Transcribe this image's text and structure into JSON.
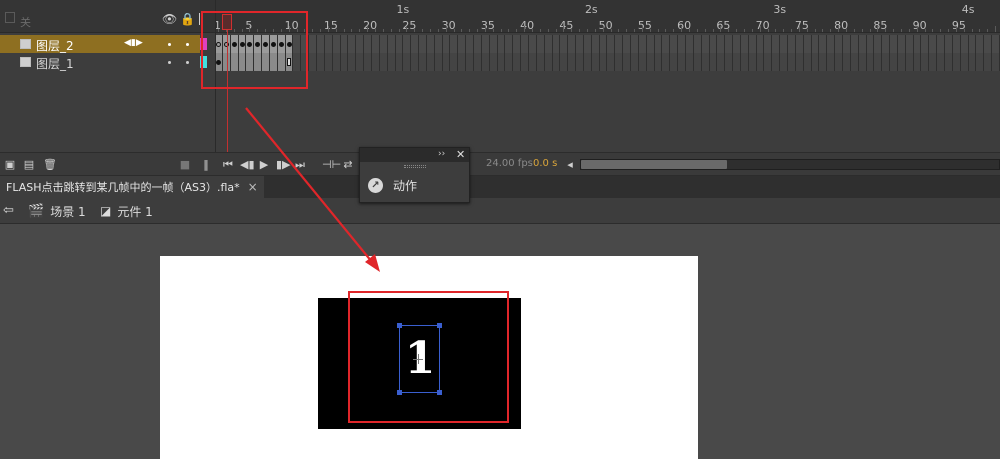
{
  "timeline": {
    "header_label": "关",
    "layers": [
      {
        "name": "图层_2",
        "selected": true,
        "color": "#e040c0"
      },
      {
        "name": "图层_1",
        "selected": false,
        "color": "#40e0e0"
      }
    ],
    "frame_numbers": [
      "1",
      "5",
      "10",
      "15",
      "20",
      "25",
      "30",
      "35",
      "40",
      "45",
      "50",
      "55",
      "60",
      "65",
      "70",
      "75",
      "80",
      "85",
      "90",
      "95"
    ],
    "seconds": [
      "1s",
      "2s",
      "3s",
      "4s"
    ],
    "current_frame": 2
  },
  "timeline_bar": {
    "fps": "24.00 fps",
    "time": "0.0 s"
  },
  "document": {
    "tab_title": "FLASH点击跳转到某几帧中的一帧（AS3）.fla*",
    "tab_close": "×"
  },
  "breadcrumb": {
    "scene": "场景 1",
    "symbol": "元件 1"
  },
  "stage": {
    "digit": "1"
  },
  "actions_panel": {
    "collapse_glyph": "››",
    "close_glyph": "✕",
    "item_label": "动作"
  },
  "colors": {
    "annotation_red": "#e0262a",
    "selected_layer": "#8e6f21",
    "selection_blue": "#3a5fd0",
    "playhead_red": "#c23030"
  }
}
